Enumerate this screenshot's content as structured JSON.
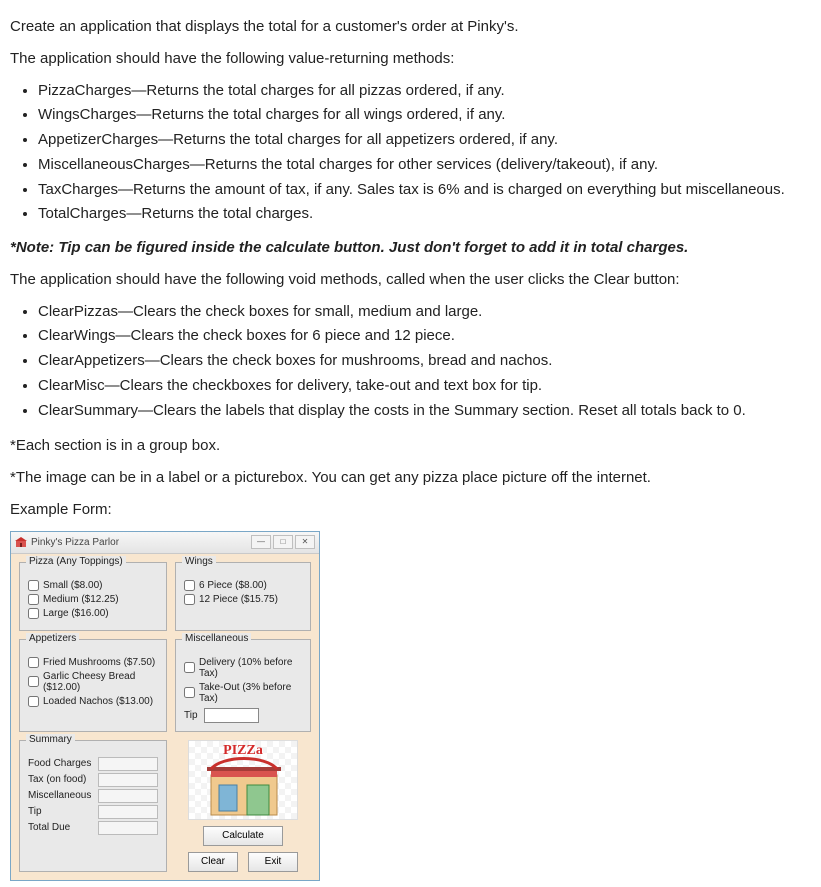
{
  "intro": "Create an application that displays the total for a customer's order at Pinky's.",
  "methods_intro": "The application should have the following value-returning methods:",
  "methods": [
    "PizzaCharges—Returns the total charges for all pizzas ordered, if any.",
    "WingsCharges—Returns the total charges for all wings ordered, if any.",
    "AppetizerCharges—Returns the total charges for all appetizers ordered, if any.",
    "MiscellaneousCharges—Returns the total charges for other services (delivery/takeout), if any.",
    "TaxCharges—Returns the amount of tax, if any. Sales tax is 6% and is charged on everything but miscellaneous.",
    "TotalCharges—Returns the total charges."
  ],
  "note_tip": "*Note: Tip can be figured inside the calculate button. Just don't forget to add it in total charges.",
  "voids_intro": "The application should have the following void methods, called when the user clicks the Clear button:",
  "voids": [
    "ClearPizzas—Clears the check boxes for small, medium and large.",
    "ClearWings—Clears the check boxes for 6 piece and 12 piece.",
    "ClearAppetizers—Clears the check boxes for mushrooms, bread and nachos.",
    "ClearMisc—Clears the checkboxes for delivery, take-out and text box for tip.",
    "ClearSummary—Clears the labels that display the costs in the Summary section.  Reset all totals back to 0."
  ],
  "note_groupbox": "*Each section is in a group box.",
  "note_image": "*The image can be in a label or a picturebox.  You can get any pizza place picture off the internet.",
  "example_label": "Example Form:",
  "form": {
    "title": "Pinky's Pizza Parlor",
    "win_min": "—",
    "win_max": "□",
    "win_close": "✕",
    "pizza": {
      "legend": "Pizza (Any Toppings)",
      "items": [
        "Small ($8.00)",
        "Medium ($12.25)",
        "Large ($16.00)"
      ]
    },
    "wings": {
      "legend": "Wings",
      "items": [
        "6 Piece ($8.00)",
        "12 Piece ($15.75)"
      ]
    },
    "appetizers": {
      "legend": "Appetizers",
      "items": [
        "Fried Mushrooms ($7.50)",
        "Garlic Cheesy Bread ($12.00)",
        "Loaded Nachos ($13.00)"
      ]
    },
    "misc": {
      "legend": "Miscellaneous",
      "items": [
        "Delivery (10% before Tax)",
        "Take-Out (3% before Tax)"
      ],
      "tip_label": "Tip",
      "tip_value": ""
    },
    "summary": {
      "legend": "Summary",
      "rows": [
        "Food Charges",
        "Tax (on food)",
        "Miscellaneous",
        "Tip",
        "Total Due"
      ]
    },
    "pizza_logo": "PIZZa",
    "buttons": {
      "calc": "Calculate",
      "clear": "Clear",
      "exit": "Exit"
    }
  }
}
